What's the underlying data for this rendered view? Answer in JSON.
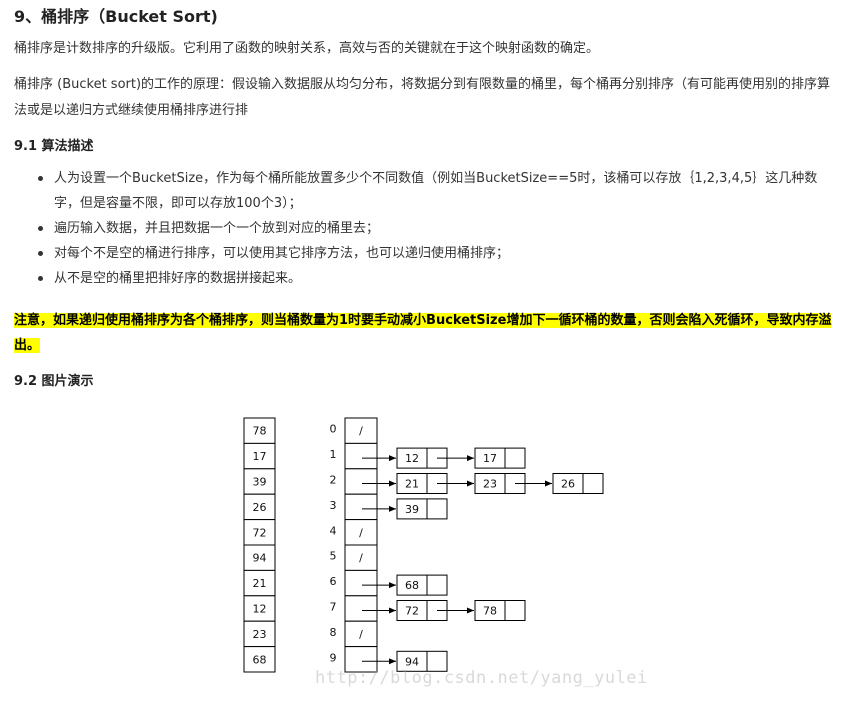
{
  "title": "9、桶排序（Bucket Sort)",
  "para1": "桶排序是计数排序的升级版。它利用了函数的映射关系，高效与否的关键就在于这个映射函数的确定。",
  "para2": "桶排序 (Bucket sort)的工作的原理：假设输入数据服从均匀分布，将数据分到有限数量的桶里，每个桶再分别排序（有可能再使用别的排序算法或是以递归方式继续使用桶排序进行排",
  "section1": "9.1 算法描述",
  "bullets": [
    "人为设置一个BucketSize，作为每个桶所能放置多少个不同数值（例如当BucketSize==5时，该桶可以存放｛1,2,3,4,5｝这几种数字，但是容量不限，即可以存放100个3）；",
    "遍历输入数据，并且把数据一个一个放到对应的桶里去；",
    "对每个不是空的桶进行排序，可以使用其它排序方法，也可以递归使用桶排序；",
    "从不是空的桶里把排好序的数据拼接起来。"
  ],
  "note": "注意，如果递归使用桶排序为各个桶排序，则当桶数量为1时要手动减小BucketSize增加下一循环桶的数量，否则会陷入死循环，导致内存溢出。",
  "section2": "9.2 图片演示",
  "diagram": {
    "input": [
      "78",
      "17",
      "39",
      "26",
      "72",
      "94",
      "21",
      "12",
      "23",
      "68"
    ],
    "buckets": [
      {
        "index": "0",
        "items": []
      },
      {
        "index": "1",
        "items": [
          "12",
          "17"
        ]
      },
      {
        "index": "2",
        "items": [
          "21",
          "23",
          "26"
        ]
      },
      {
        "index": "3",
        "items": [
          "39"
        ]
      },
      {
        "index": "4",
        "items": []
      },
      {
        "index": "5",
        "items": []
      },
      {
        "index": "6",
        "items": [
          "68"
        ]
      },
      {
        "index": "7",
        "items": [
          "72",
          "78"
        ]
      },
      {
        "index": "8",
        "items": []
      },
      {
        "index": "9",
        "items": [
          "94"
        ]
      }
    ],
    "empty_marker": "/"
  },
  "watermark": "http://blog.csdn.net/yang_yulei"
}
